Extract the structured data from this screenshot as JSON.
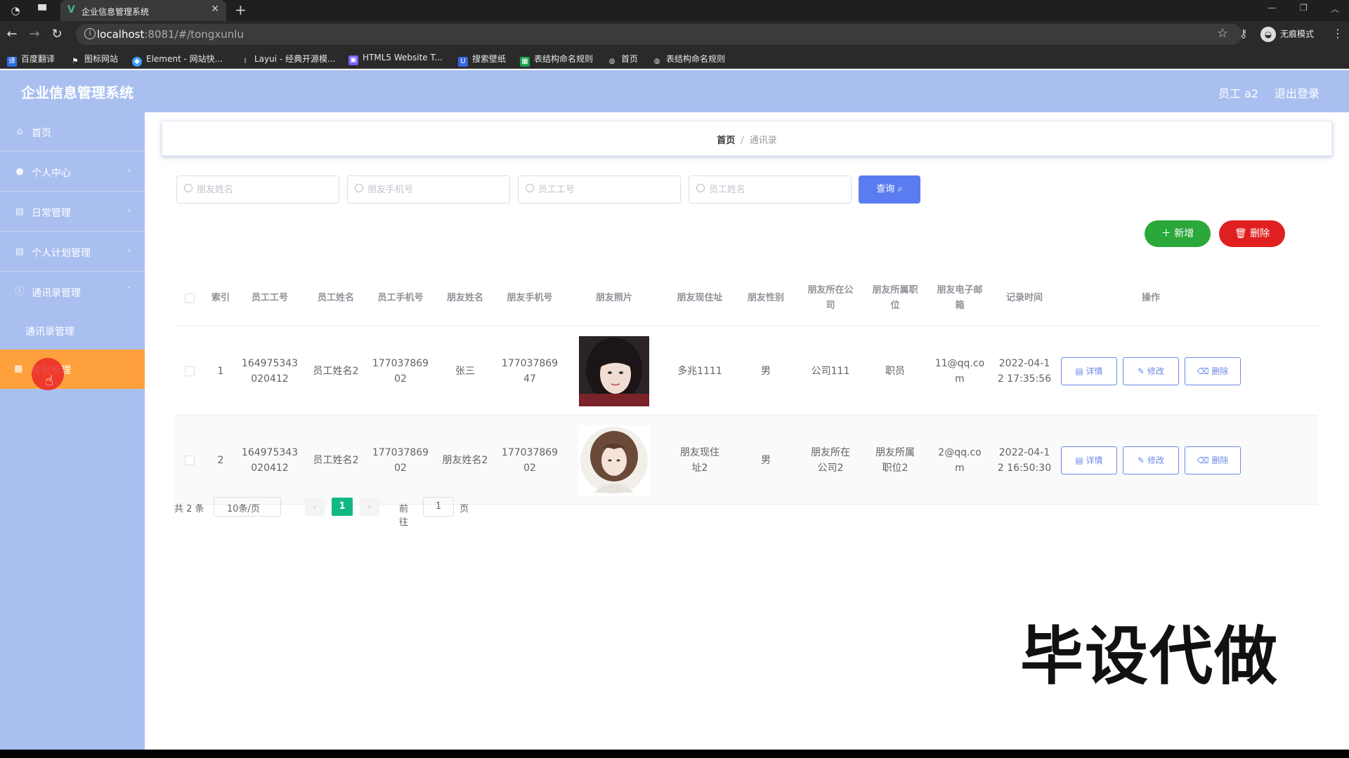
{
  "browser": {
    "tab_title": "企业信息管理系统",
    "url_host": "localhost",
    "url_path": ":8081/#/tongxunlu",
    "incognito_label": "无痕模式",
    "bookmarks": [
      "百度翻译",
      "图标网站",
      "Element - 网站快...",
      "Layui - 经典开源模...",
      "HTML5 Website T...",
      "搜索壁纸",
      "表结构命名规则",
      "首页",
      "表结构命名规则"
    ]
  },
  "header": {
    "title": "企业信息管理系统",
    "user": "员工 a2",
    "logout": "退出登录"
  },
  "sidebar": {
    "items": [
      {
        "label": "首页",
        "icon": "home-icon"
      },
      {
        "label": "个人中心",
        "icon": "user-icon"
      },
      {
        "label": "日常管理",
        "icon": "doc-icon"
      },
      {
        "label": "个人计划管理",
        "icon": "doc-icon"
      },
      {
        "label": "通讯录管理",
        "icon": "info-icon"
      }
    ],
    "sub_item": "通讯录管理",
    "active_item": "考勤管理"
  },
  "breadcrumb": {
    "home": "首页",
    "separator": "/",
    "current": "通讯录"
  },
  "search": {
    "friend_name_placeholder": "朋友姓名",
    "friend_phone_placeholder": "朋友手机号",
    "emp_id_placeholder": "员工工号",
    "emp_name_placeholder": "员工姓名",
    "query_label": "查询"
  },
  "actions": {
    "add_label": "新增",
    "delete_label": "删除"
  },
  "table": {
    "columns": [
      "索引",
      "员工工号",
      "员工姓名",
      "员工手机号",
      "朋友姓名",
      "朋友手机号",
      "朋友照片",
      "朋友现住址",
      "朋友性别",
      "朋友所在公司",
      "朋友所属职位",
      "朋友电子邮箱",
      "记录时间",
      "操作"
    ],
    "rows": [
      {
        "index": "1",
        "emp_id": "164975343020412",
        "emp_name": "员工姓名2",
        "emp_phone": "17703786902",
        "friend_name": "张三",
        "friend_phone": "17703786947",
        "address": "多兆1111",
        "gender": "男",
        "company": "公司111",
        "position": "职员",
        "email": "11@qq.com",
        "time": "2022-04-12 17:35:56"
      },
      {
        "index": "2",
        "emp_id": "164975343020412",
        "emp_name": "员工姓名2",
        "emp_phone": "17703786902",
        "friend_name": "朋友姓名2",
        "friend_phone": "17703786902",
        "address": "朋友现住址2",
        "gender": "男",
        "company": "朋友所在公司2",
        "position": "朋友所属职位2",
        "email": "2@qq.com",
        "time": "2022-04-12 16:50:30"
      }
    ],
    "row_actions": {
      "detail": "详情",
      "edit": "修改",
      "delete": "删除"
    }
  },
  "pagination": {
    "total": "共 2 条",
    "page_size": "10条/页",
    "current_page": "1",
    "goto_label": "前往",
    "goto_value": "1",
    "unit": "页"
  },
  "watermark": "毕设代做"
}
